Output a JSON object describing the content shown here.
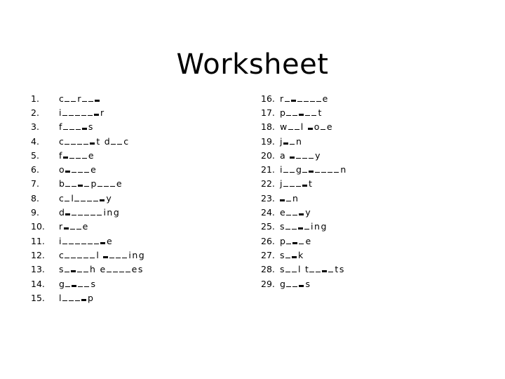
{
  "title": "Worksheet",
  "legend": {
    "thin_blank": "_",
    "thick_blank": "=",
    "space": " "
  },
  "items": [
    {
      "number": "1.",
      "pattern": "c__r__="
    },
    {
      "number": "2.",
      "pattern": "i_____=r"
    },
    {
      "number": "3.",
      "pattern": "f___=s"
    },
    {
      "number": "4.",
      "pattern": "c____=t d__c"
    },
    {
      "number": "5.",
      "pattern": "f=___e"
    },
    {
      "number": "6.",
      "pattern": "o=___e"
    },
    {
      "number": "7.",
      "pattern": "b__=_p___e"
    },
    {
      "number": "8.",
      "pattern": "c_l____=y"
    },
    {
      "number": "9.",
      "pattern": "d=_____ing"
    },
    {
      "number": "10.",
      "pattern": "r=__e"
    },
    {
      "number": "11.",
      "pattern": "i______=e"
    },
    {
      "number": "12.",
      "pattern": "c_____l =___ing"
    },
    {
      "number": "13.",
      "pattern": "s_=__h e____es"
    },
    {
      "number": "14.",
      "pattern": "g_=__s"
    },
    {
      "number": "15.",
      "pattern": "l___=p"
    },
    {
      "number": "16.",
      "pattern": "r_=____e"
    },
    {
      "number": "17.",
      "pattern": "p__=__t"
    },
    {
      "number": "18.",
      "pattern": "w__l =o_e"
    },
    {
      "number": "19.",
      "pattern": "j=_n"
    },
    {
      "number": "20.",
      "pattern": "a =___y"
    },
    {
      "number": "21.",
      "pattern": "i__g_=____n"
    },
    {
      "number": "22.",
      "pattern": "j___=t"
    },
    {
      "number": "23.",
      "pattern": "=_n"
    },
    {
      "number": "24.",
      "pattern": "e__=y"
    },
    {
      "number": "25.",
      "pattern": "s__=_ing"
    },
    {
      "number": "26.",
      "pattern": "p_=_e"
    },
    {
      "number": "27.",
      "pattern": "s_=k"
    },
    {
      "number": "28.",
      "pattern": "s__l t__=_ts"
    },
    {
      "number": "29.",
      "pattern": "g__=s"
    }
  ]
}
